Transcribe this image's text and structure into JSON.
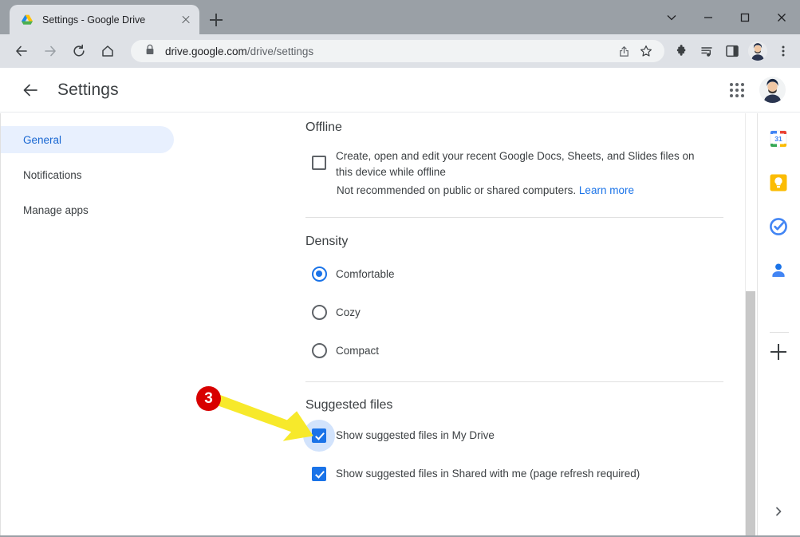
{
  "browser": {
    "tab": {
      "title": "Settings - Google Drive",
      "favicon": "google-drive-logo-icon",
      "close": "close-tab-icon"
    },
    "new_tab_label": "+",
    "window_controls": {
      "minimize_to_tray": "chevron-down-icon",
      "minimize": "minimize-icon",
      "maximize": "maximize-icon",
      "close": "close-window-icon"
    },
    "toolbar": {
      "back": "back-arrow-icon",
      "forward": "forward-arrow-icon",
      "reload": "reload-icon",
      "home": "home-icon",
      "lock": "lock-icon",
      "url_domain": "drive.google.com",
      "url_path": "/drive/settings",
      "url_full": "drive.google.com/drive/settings",
      "share": "share-icon",
      "bookmark": "star-icon",
      "extensions": "puzzle-piece-icon",
      "media": "media-control-icon",
      "side_panel": "side-panel-icon",
      "profile": "profile-avatar-icon",
      "menu": "three-dot-menu-icon"
    }
  },
  "header": {
    "back_label": "back-arrow",
    "title": "Settings",
    "apps_label": "google-apps-grid",
    "account_label": "google-account-avatar"
  },
  "sidebar": {
    "items": [
      {
        "label": "General",
        "active": true
      },
      {
        "label": "Notifications",
        "active": false
      },
      {
        "label": "Manage apps",
        "active": false
      }
    ]
  },
  "settings": {
    "offline": {
      "title": "Offline",
      "checkbox_label": "Create, open and edit your recent Google Docs, Sheets, and Slides files on this device while offline",
      "checked": false,
      "note_text": "Not recommended on public or shared computers.",
      "note_link": "Learn more"
    },
    "density": {
      "title": "Density",
      "options": [
        {
          "label": "Comfortable",
          "selected": true
        },
        {
          "label": "Cozy",
          "selected": false
        },
        {
          "label": "Compact",
          "selected": false
        }
      ]
    },
    "suggested_files": {
      "title": "Suggested files",
      "options": [
        {
          "label": "Show suggested files in My Drive",
          "checked": true,
          "focused": true
        },
        {
          "label": "Show suggested files in Shared with me (page refresh required)",
          "checked": true,
          "focused": false
        }
      ]
    }
  },
  "side_panel": {
    "items": [
      {
        "name": "google-calendar-icon"
      },
      {
        "name": "google-keep-icon"
      },
      {
        "name": "google-tasks-icon"
      },
      {
        "name": "google-contacts-icon"
      }
    ],
    "add_label": "+",
    "expand_label": "chevron-right"
  },
  "annotation": {
    "step_number": "3",
    "badge_color": "#d80000",
    "arrow_color": "#f7e92b"
  },
  "colors": {
    "accent_blue": "#1a73e8",
    "link_blue": "#1967d2",
    "active_pill": "#e8f0fe",
    "focus_ring": "#d2e3fc",
    "text": "#3c4043",
    "chrome_gray": "#dee1e6",
    "titlebar_gray": "#9aa0a6"
  }
}
